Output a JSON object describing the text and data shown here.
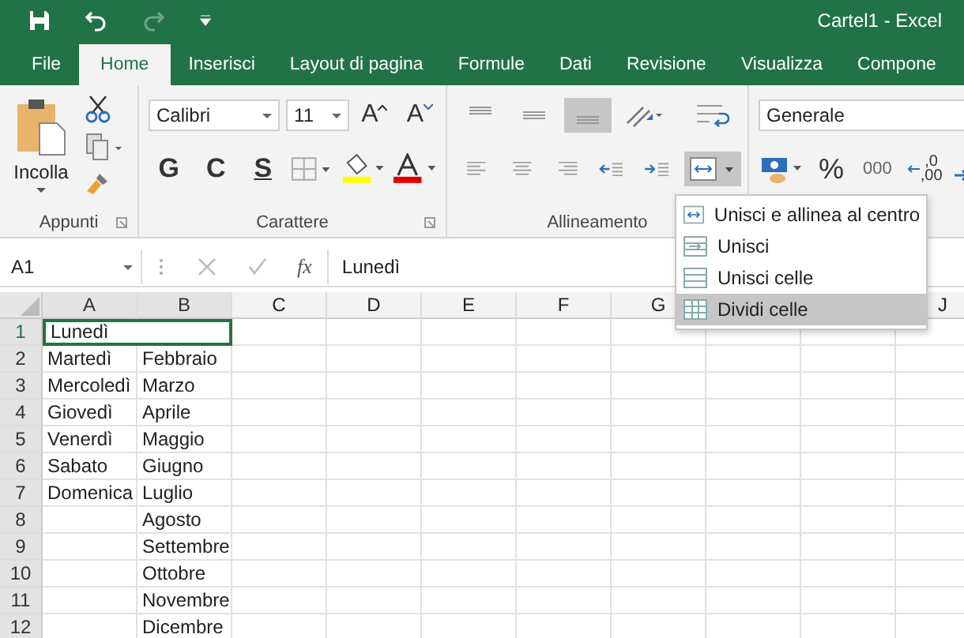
{
  "window": {
    "title": "Cartel1 - Excel"
  },
  "tabs": [
    {
      "label": "File",
      "selected": false
    },
    {
      "label": "Home",
      "selected": true
    },
    {
      "label": "Inserisci",
      "selected": false
    },
    {
      "label": "Layout di pagina",
      "selected": false
    },
    {
      "label": "Formule",
      "selected": false
    },
    {
      "label": "Dati",
      "selected": false
    },
    {
      "label": "Revisione",
      "selected": false
    },
    {
      "label": "Visualizza",
      "selected": false
    },
    {
      "label": "Compone",
      "selected": false
    }
  ],
  "ribbon": {
    "clipboard": {
      "paste_label": "Incolla",
      "group_label": "Appunti"
    },
    "font": {
      "family": "Calibri",
      "size": "11",
      "grow": "A",
      "shrink": "A",
      "bold": "G",
      "italic": "C",
      "underline": "S",
      "group_label": "Carattere"
    },
    "alignment": {
      "vertical": [
        {
          "selected": false
        },
        {
          "selected": false
        },
        {
          "selected": true
        }
      ],
      "merge_open": true,
      "group_label": "Allineamento"
    },
    "number": {
      "format": "Generale",
      "percent": "%",
      "thousands": "000",
      "decimal_top": ",0",
      "decimal_bottom": ",00"
    }
  },
  "merge_menu": [
    {
      "label": "Unisci e allinea al centro",
      "selected": false
    },
    {
      "label": "Unisci",
      "selected": false
    },
    {
      "label": "Unisci celle",
      "selected": false
    },
    {
      "label": "Dividi celle",
      "selected": true
    }
  ],
  "formula_bar": {
    "name_box": "A1",
    "fx": "fx",
    "value": "Lunedì"
  },
  "sheet": {
    "columns": [
      "A",
      "B",
      "C",
      "D",
      "E",
      "F",
      "G",
      "J"
    ],
    "rows": [
      {
        "number": "1",
        "a": "Lunedì",
        "merged": true,
        "selected": true
      },
      {
        "number": "2",
        "a": "Martedì",
        "b": "Febbraio"
      },
      {
        "number": "3",
        "a": "Mercoledì",
        "b": "Marzo"
      },
      {
        "number": "4",
        "a": "Giovedì",
        "b": "Aprile"
      },
      {
        "number": "5",
        "a": "Venerdì",
        "b": "Maggio"
      },
      {
        "number": "6",
        "a": "Sabato",
        "b": "Giugno"
      },
      {
        "number": "7",
        "a": "Domenica",
        "b": "Luglio"
      },
      {
        "number": "8",
        "b": "Agosto"
      },
      {
        "number": "9",
        "b": "Settembre"
      },
      {
        "number": "10",
        "b": "Ottobre"
      },
      {
        "number": "11",
        "b": "Novembre"
      },
      {
        "number": "12",
        "b": "Dicembre"
      }
    ]
  }
}
